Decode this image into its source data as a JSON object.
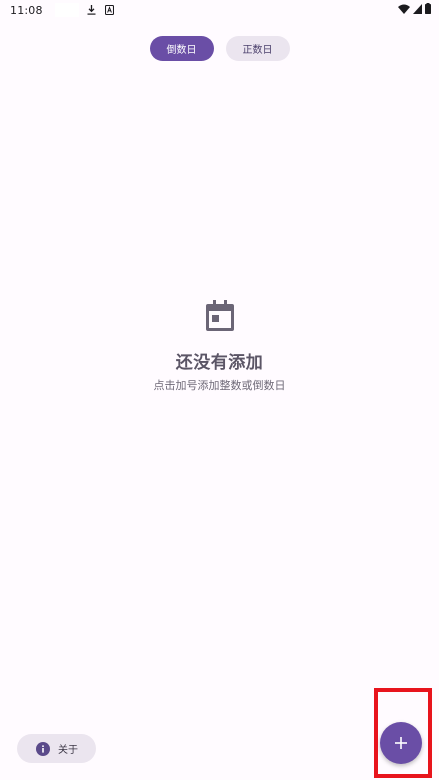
{
  "status_bar": {
    "time": "11:08",
    "icons": [
      "download-icon",
      "a-icon",
      "wifi-icon",
      "signal-icon",
      "battery-icon"
    ]
  },
  "tabs": [
    {
      "label": "倒数日",
      "active": true
    },
    {
      "label": "正数日",
      "active": false
    }
  ],
  "empty_state": {
    "icon": "calendar-icon",
    "title": "还没有添加",
    "subtitle": "点击加号添加整数或倒数日"
  },
  "about_button": {
    "icon": "info-icon",
    "label": "关于"
  },
  "fab": {
    "icon": "plus-icon"
  },
  "colors": {
    "accent": "#6a4ea6",
    "background": "#fffbff",
    "tonal": "#ebe5ef",
    "highlight": "#e8141d"
  }
}
